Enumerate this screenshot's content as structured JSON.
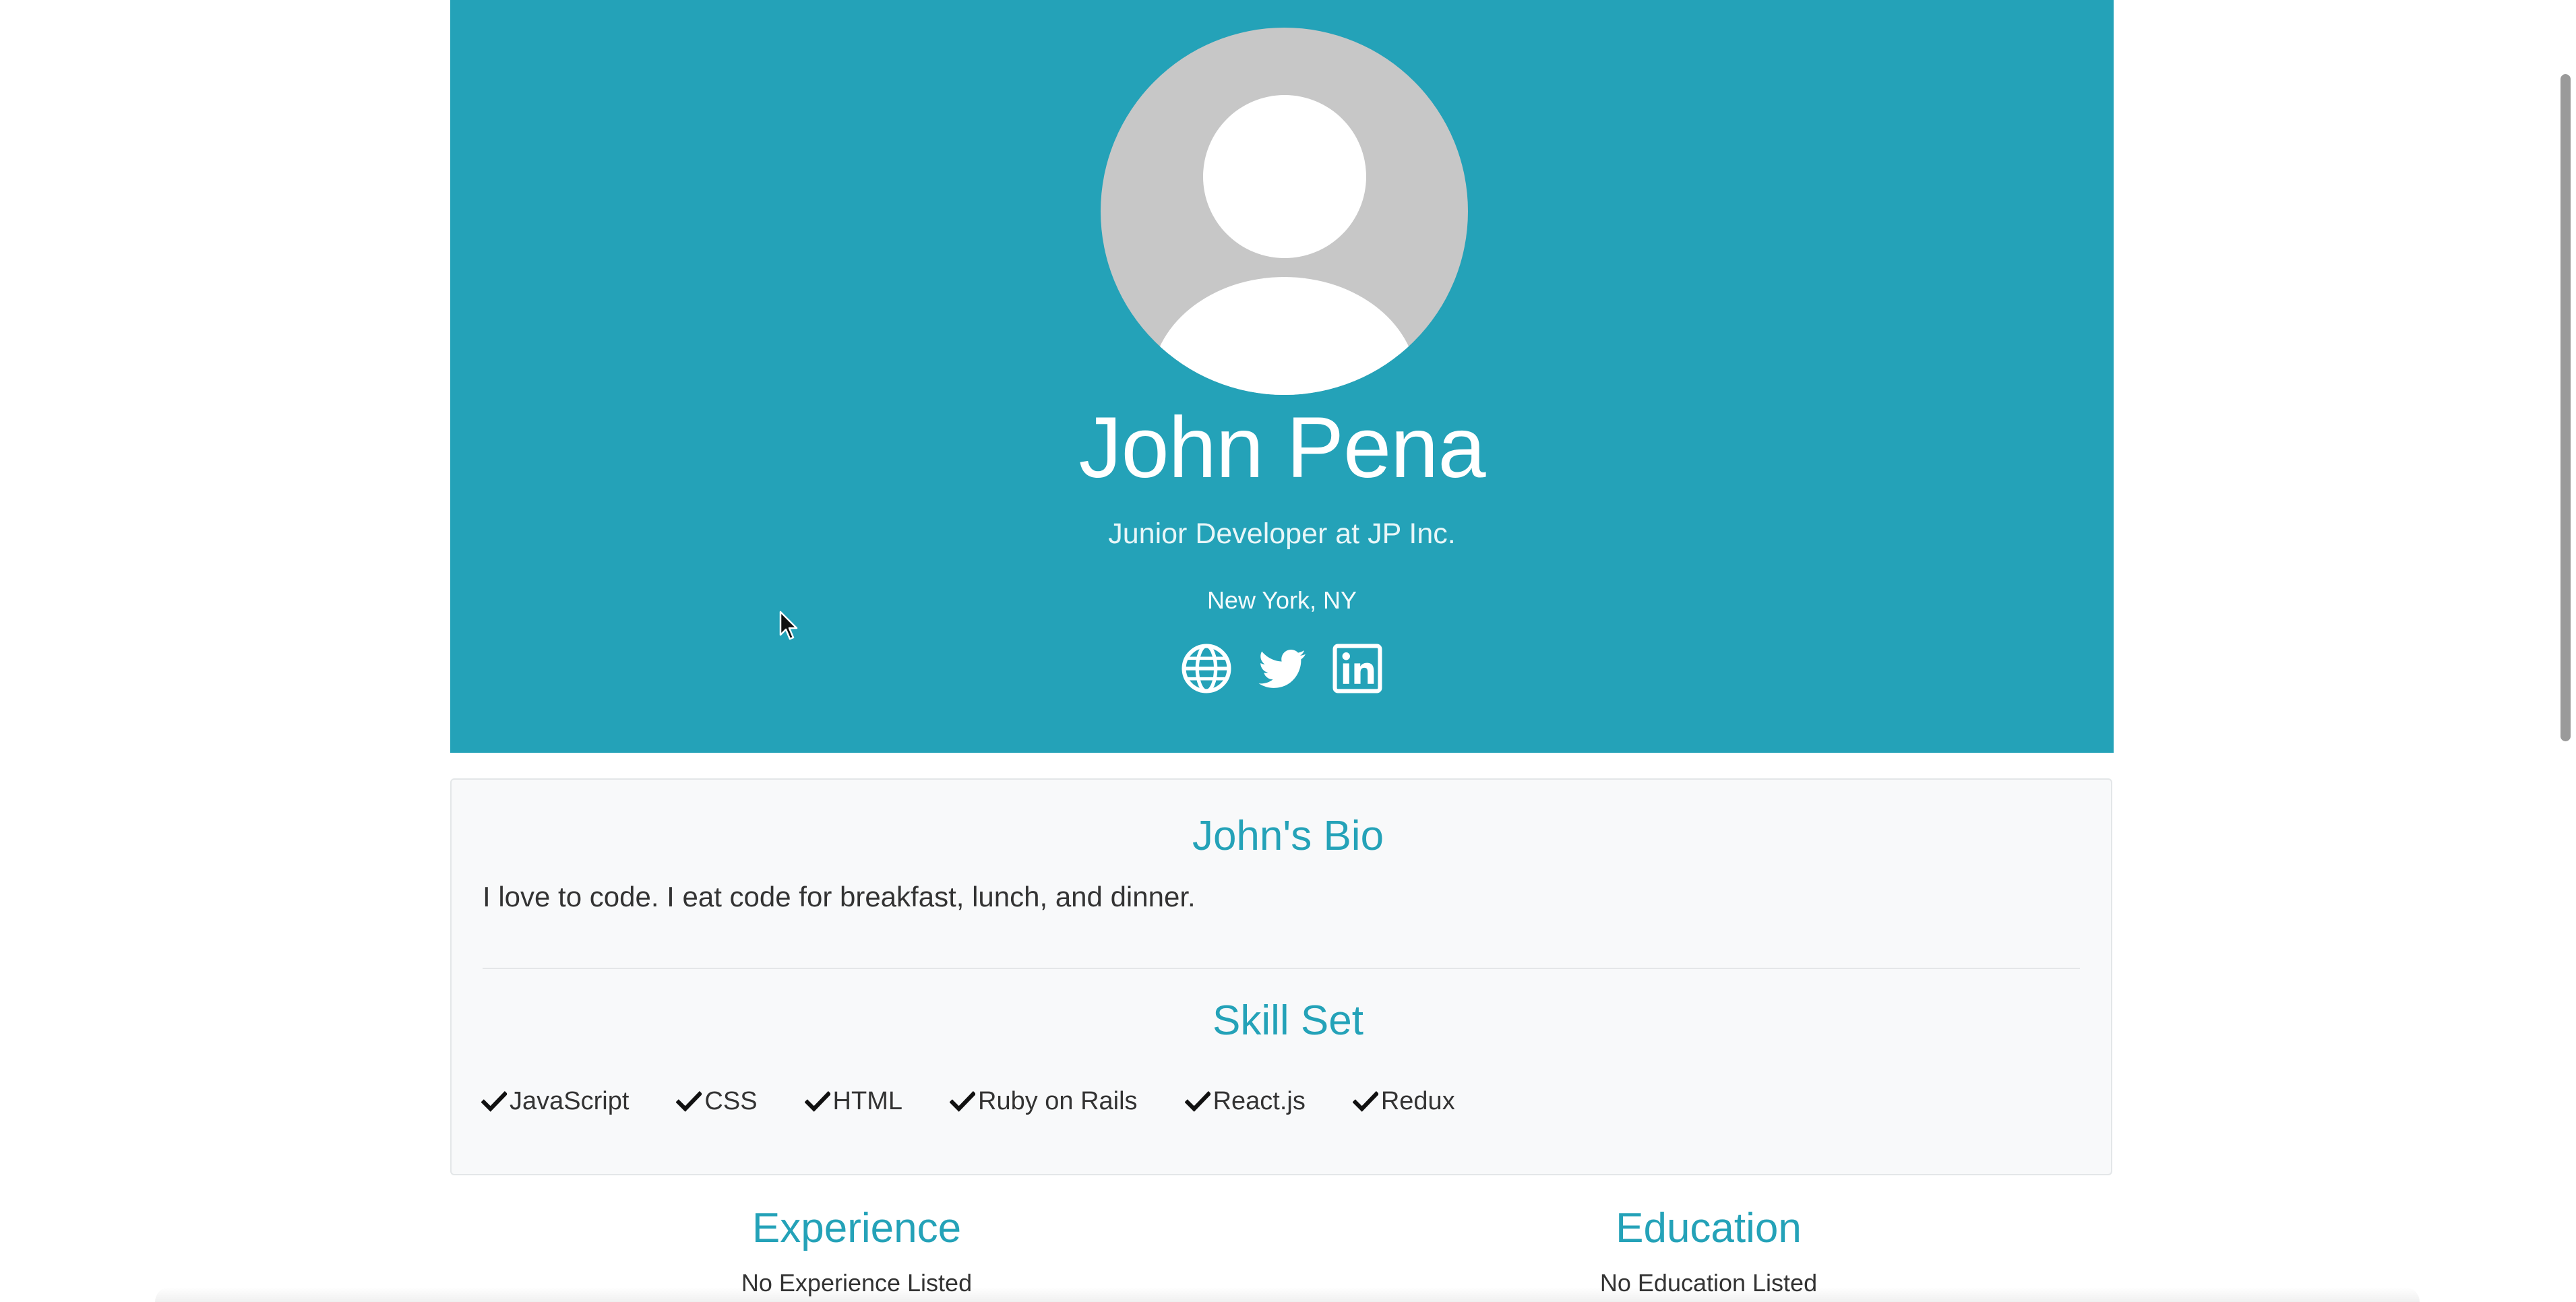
{
  "profile": {
    "name": "John Pena",
    "title": "Junior Developer at JP Inc.",
    "location": "New York, NY",
    "social_icons": [
      "globe-icon",
      "twitter-icon",
      "linkedin-icon"
    ]
  },
  "bio": {
    "heading": "John's Bio",
    "text": "I love to code. I eat code for breakfast, lunch, and dinner."
  },
  "skills": {
    "heading": "Skill Set",
    "items": [
      "JavaScript",
      "CSS",
      "HTML",
      "Ruby on Rails",
      "React.js",
      "Redux"
    ]
  },
  "experience": {
    "heading": "Experience",
    "empty_text": "No Experience Listed"
  },
  "education": {
    "heading": "Education",
    "empty_text": "No Education Listed"
  },
  "colors": {
    "accent": "#24a2b8",
    "card_bg": "#f8f9fa",
    "avatar_bg": "#c7c7c7"
  }
}
